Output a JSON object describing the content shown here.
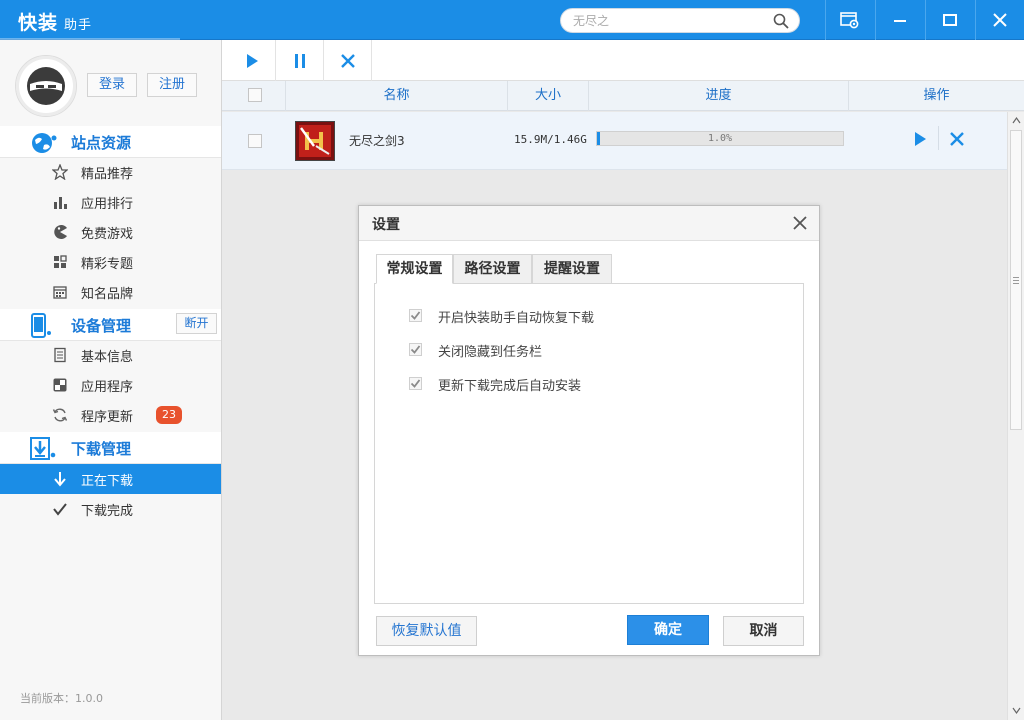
{
  "app": {
    "logo_main": "快装",
    "logo_sub": "助手",
    "search_placeholder": "无尽之"
  },
  "auth": {
    "login": "登录",
    "register": "注册"
  },
  "sidebar": {
    "site_resources": {
      "title": "站点资源",
      "items": [
        {
          "label": "精品推荐",
          "icon": "star-icon"
        },
        {
          "label": "应用排行",
          "icon": "bar-chart-icon"
        },
        {
          "label": "免费游戏",
          "icon": "pacman-icon"
        },
        {
          "label": "精彩专题",
          "icon": "grid-icon"
        },
        {
          "label": "知名品牌",
          "icon": "calendar-icon"
        }
      ]
    },
    "device": {
      "title": "设备管理",
      "disconnect": "断开",
      "items": [
        {
          "label": "基本信息",
          "icon": "document-icon"
        },
        {
          "label": "应用程序",
          "icon": "apps-icon"
        },
        {
          "label": "程序更新",
          "icon": "refresh-icon",
          "badge": "23"
        }
      ]
    },
    "download": {
      "title": "下载管理",
      "items": [
        {
          "label": "正在下载",
          "icon": "download-arrow-icon",
          "active": true
        },
        {
          "label": "下载完成",
          "icon": "checkmark-icon"
        }
      ]
    },
    "version": "当前版本：1.0.0"
  },
  "table": {
    "columns": [
      "名称",
      "大小",
      "进度",
      "操作"
    ],
    "rows": [
      {
        "name": "无尽之剑3",
        "size": "15.9M/1.46G",
        "progress_text": "1.0%",
        "progress": 0.01
      }
    ]
  },
  "dialog": {
    "title": "设置",
    "tabs": [
      "常规设置",
      "路径设置",
      "提醒设置"
    ],
    "options": [
      {
        "label": "开启快装助手自动恢复下载",
        "checked": true
      },
      {
        "label": "关闭隐藏到任务栏",
        "checked": true
      },
      {
        "label": "更新下载完成后自动安装",
        "checked": true
      }
    ],
    "restore_default": "恢复默认值",
    "ok": "确定",
    "cancel": "取消"
  },
  "colors": {
    "primary": "#1b8de6",
    "accent_text": "#1c7bd8",
    "badge": "#e8522d"
  }
}
